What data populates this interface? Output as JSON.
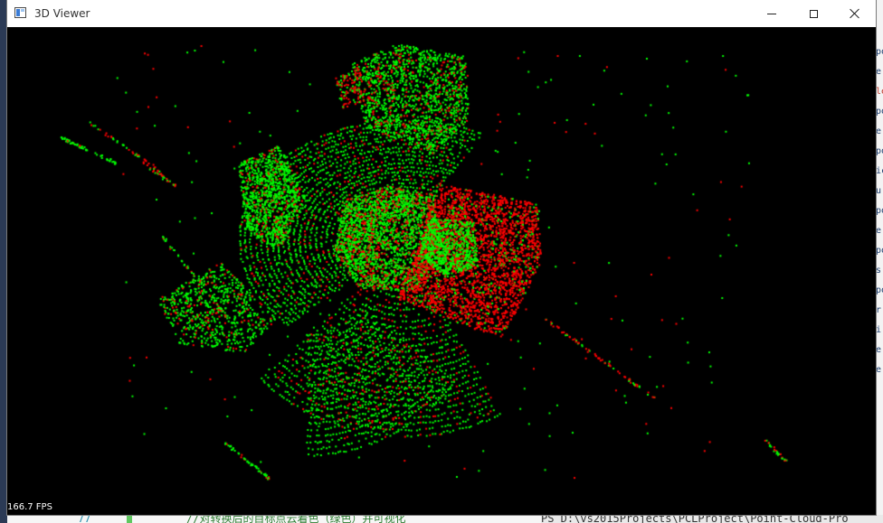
{
  "window": {
    "title": "3D Viewer"
  },
  "viewer": {
    "fps": "166.7 FPS",
    "background_color": "#000000",
    "point_colors": {
      "target": "#00ff00",
      "source": "#ff0000"
    }
  },
  "background_editor": {
    "line_number": "77",
    "comment_text": "//对转换后的目标点云着色（绿色）并可视化",
    "terminal_text": "PS D:\\vs2015Projects\\PCLProject\\Point-Cloud-Pro",
    "right_tokens": [
      "po",
      "e",
      "le",
      "po",
      "e",
      "po",
      "ic",
      "u",
      "po",
      "e",
      "po",
      "s",
      "po",
      "r",
      "i",
      "e",
      "e"
    ]
  }
}
